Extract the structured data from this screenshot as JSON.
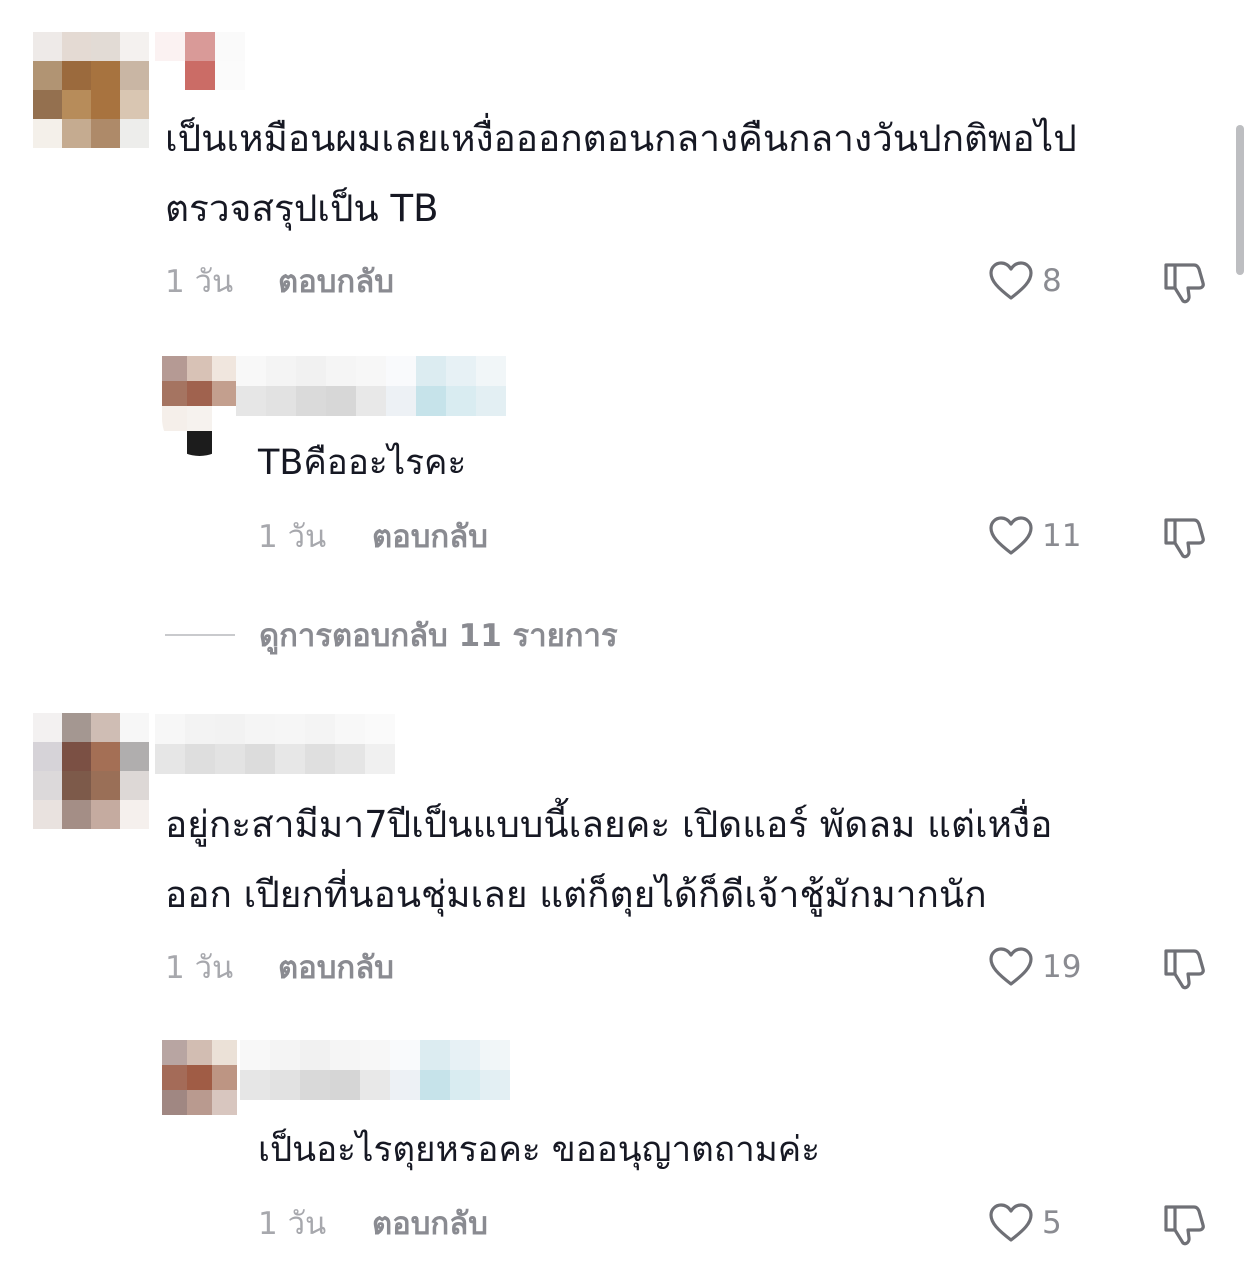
{
  "comments": [
    {
      "text_lines": [
        "เป็นเหมือนผมเลยเหงื่อออกตอนกลางคืนกลางวันปกติพอไป",
        "ตรวจสรุปเป็น TB"
      ],
      "time": "1 วัน",
      "reply_label": "ตอบกลับ",
      "likes": "8"
    },
    {
      "text_lines": [
        "TBคืออะไรคะ"
      ],
      "time": "1 วัน",
      "reply_label": "ตอบกลับ",
      "likes": "11"
    },
    {
      "text_lines": [
        "อยู่กะสามีมา7ปีเป็นแบบนี้เลยคะ เปิดแอร์ พัดลม แต่เหงื่อ",
        "ออก เปียกที่นอนชุ่มเลย แต่ก็ตุยได้ก็ดีเจ้าชู้มักมากนัก"
      ],
      "time": "1 วัน",
      "reply_label": "ตอบกลับ",
      "likes": "19"
    },
    {
      "text_lines": [
        "เป็นอะไรตุยหรอคะ ขออนุญาตถามค่ะ"
      ],
      "time": "1 วัน",
      "reply_label": "ตอบกลับ",
      "likes": "5"
    }
  ],
  "view_replies_label": "ดูการตอบกลับ 11 รายการ",
  "icons": {
    "like": "heart-outline-icon",
    "dislike": "thumbs-down-outline-icon"
  },
  "colors": {
    "text": "#161823",
    "muted": "#8a8b91",
    "time": "#a7a8ad"
  }
}
